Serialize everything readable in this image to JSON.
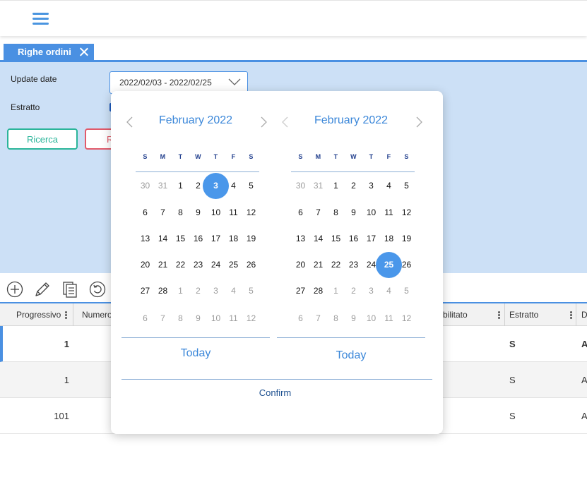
{
  "topbar": {
    "menu_icon": "hamburger-menu-icon"
  },
  "tab": {
    "label": "Righe ordini",
    "close_icon": "close-icon"
  },
  "filters": {
    "update_date_label": "Update date",
    "update_date_value": "2022/02/03 - 2022/02/25",
    "estratto_label": "Estratto",
    "search_button": "Ricerca",
    "reset_button": "R"
  },
  "toolbar": {
    "icons": [
      "add-circle-icon",
      "edit-pencil-icon",
      "copy-documents-icon",
      "refresh-icon"
    ]
  },
  "table": {
    "headers": [
      "Progressivo",
      "Numero",
      "bilitato",
      "Estratto",
      "D"
    ],
    "rows": [
      {
        "progressivo": "1",
        "estratto": "S",
        "d": "A"
      },
      {
        "progressivo": "1",
        "estratto": "S",
        "d": "A"
      },
      {
        "progressivo": "101",
        "estratto": "S",
        "d": "A"
      }
    ]
  },
  "datepicker": {
    "weekdays": [
      "S",
      "M",
      "T",
      "W",
      "T",
      "F",
      "S"
    ],
    "left": {
      "title": "February 2022",
      "today_label": "Today",
      "selected_day": "3",
      "weeks": [
        [
          "30",
          "31",
          "1",
          "2",
          "3",
          "4",
          "5"
        ],
        [
          "6",
          "7",
          "8",
          "9",
          "10",
          "11",
          "12"
        ],
        [
          "13",
          "14",
          "15",
          "16",
          "17",
          "18",
          "19"
        ],
        [
          "20",
          "21",
          "22",
          "23",
          "24",
          "25",
          "26"
        ],
        [
          "27",
          "28",
          "1",
          "2",
          "3",
          "4",
          "5"
        ],
        [
          "6",
          "7",
          "8",
          "9",
          "10",
          "11",
          "12"
        ]
      ]
    },
    "right": {
      "title": "February 2022",
      "today_label": "Today",
      "selected_day": "25",
      "weeks": [
        [
          "30",
          "31",
          "1",
          "2",
          "3",
          "4",
          "5"
        ],
        [
          "6",
          "7",
          "8",
          "9",
          "10",
          "11",
          "12"
        ],
        [
          "13",
          "14",
          "15",
          "16",
          "17",
          "18",
          "19"
        ],
        [
          "20",
          "21",
          "22",
          "23",
          "24",
          "25",
          "26"
        ],
        [
          "27",
          "28",
          "1",
          "2",
          "3",
          "4",
          "5"
        ],
        [
          "6",
          "7",
          "8",
          "9",
          "10",
          "11",
          "12"
        ]
      ]
    },
    "confirm_label": "Confirm",
    "accent_color": "#4a97ea"
  }
}
